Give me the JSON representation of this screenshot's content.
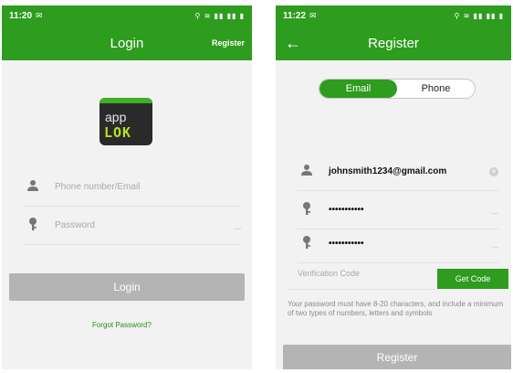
{
  "login_screen": {
    "status_time": "11:20",
    "title": "Login",
    "register_link": "Register",
    "logo_text_top": "app",
    "logo_text_bottom": "LOK",
    "phone_placeholder": "Phone number/Email",
    "password_placeholder": "Password",
    "login_button": "Login",
    "forgot_link": "Forgot Password?"
  },
  "register_screen": {
    "status_time": "11:22",
    "title": "Register",
    "tabs": [
      "Email",
      "Phone"
    ],
    "email_value": "johnsmith1234@gmail.com",
    "password_value": "•••••••••••",
    "confirm_password_value": "•••••••••••",
    "verification_placeholder": "Verification Code",
    "get_code_button": "Get Code",
    "password_hint": "Your password must have 8-20 characters, and include a minimum of two types of numbers, letters and symbols",
    "register_button": "Register"
  },
  "colors": {
    "accent": "#2e9c1e",
    "button_disabled": "#b4b4b4"
  },
  "icons": [
    "person-icon",
    "key-icon",
    "eye-hidden-icon",
    "clear-icon",
    "back-arrow-icon"
  ]
}
